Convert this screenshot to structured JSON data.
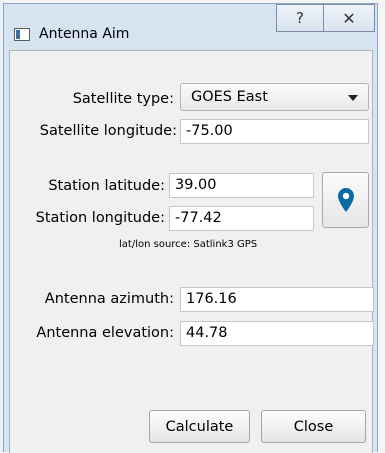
{
  "window": {
    "title": "Antenna Aim",
    "help_glyph": "?",
    "close_glyph": "✕"
  },
  "form": {
    "satellite_type": {
      "label": "Satellite type:",
      "value": "GOES East"
    },
    "satellite_longitude": {
      "label": "Satellite longitude:",
      "value": "-75.00"
    },
    "station_latitude": {
      "label": "Station latitude:",
      "value": "39.00"
    },
    "station_longitude": {
      "label": "Station longitude:",
      "value": "-77.42"
    },
    "latlon_source": "lat/lon source: Satlink3 GPS",
    "antenna_azimuth": {
      "label": "Antenna azimuth:",
      "value": "176.16"
    },
    "antenna_elevation": {
      "label": "Antenna elevation:",
      "value": "44.78"
    }
  },
  "buttons": {
    "calculate": "Calculate",
    "close": "Close"
  },
  "icons": {
    "app": "app-window-icon",
    "location": "map-pin-icon",
    "combo_arrow": "chevron-down-icon"
  },
  "colors": {
    "pin": "#0a6aa8",
    "frame": "#d6e3f1"
  }
}
